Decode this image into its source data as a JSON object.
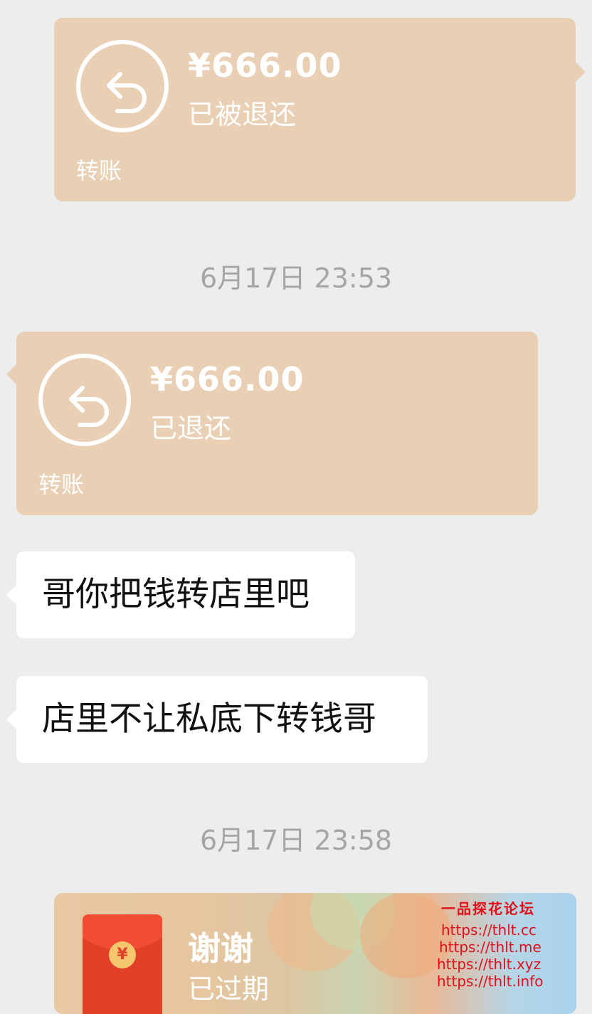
{
  "transfers": [
    {
      "amount": "¥666.00",
      "status": "已被退还",
      "label": "转账"
    },
    {
      "amount": "¥666.00",
      "status": "已退还",
      "label": "转账"
    }
  ],
  "timestamps": [
    "6月17日 23:53",
    "6月17日 23:58"
  ],
  "messages": [
    "哥你把钱转店里吧",
    "店里不让私底下转钱哥"
  ],
  "red_packet": {
    "title": "谢谢",
    "status": "已过期",
    "coin": "¥"
  },
  "watermark": {
    "title": "一品探花论坛",
    "links": [
      "https://thlt.cc",
      "https://thlt.me",
      "https://thlt.xyz",
      "https://thlt.info"
    ]
  },
  "colors": {
    "background": "#ededed",
    "transfer_card": "#e9cfb4",
    "red_packet": "#e13f28",
    "watermark": "#e0101b"
  },
  "icons": [
    "refund-arrow-icon",
    "red-envelope-icon"
  ]
}
